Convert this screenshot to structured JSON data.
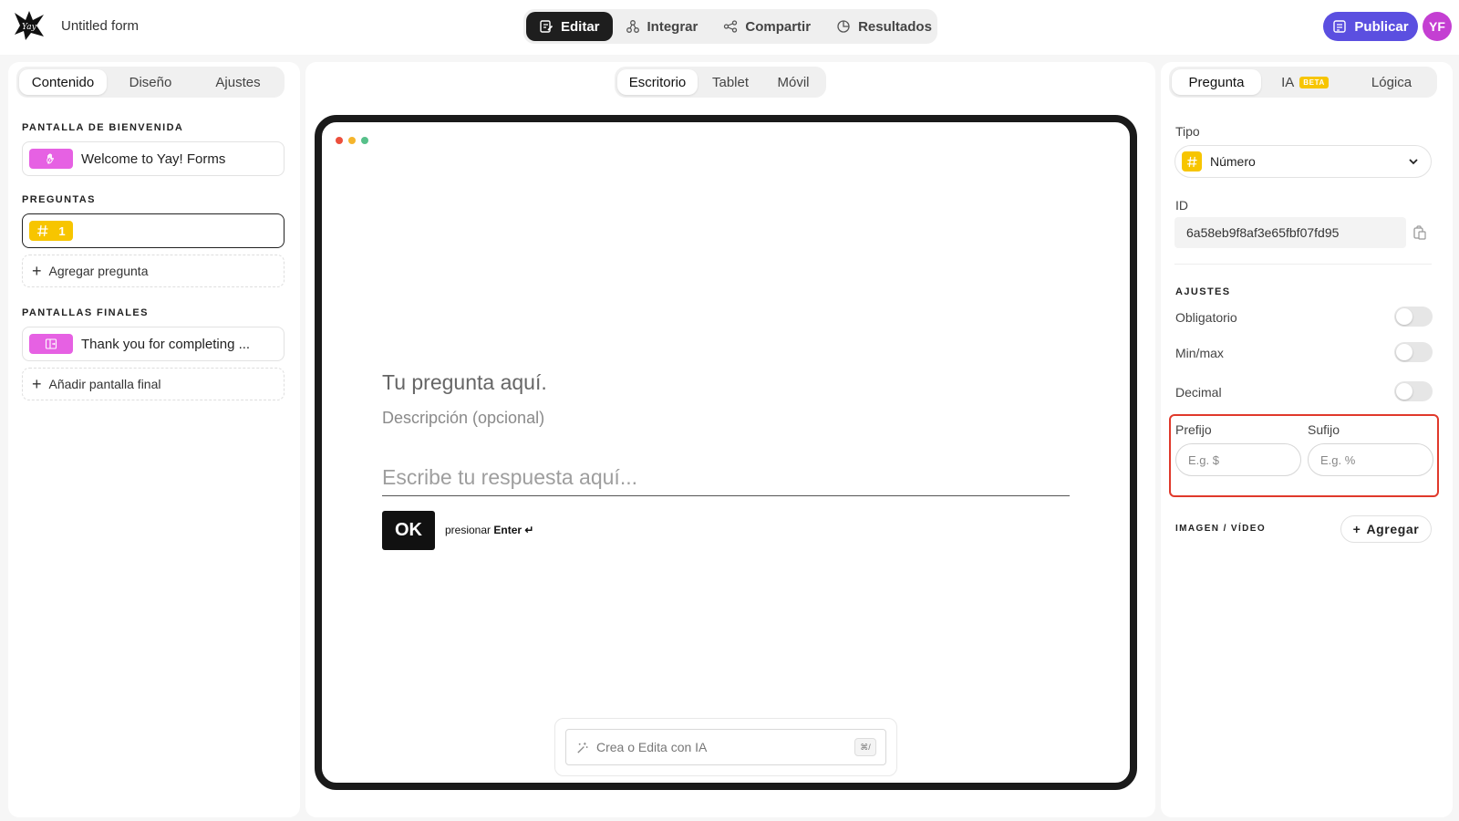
{
  "app": {
    "form_title": "Untitled form",
    "user_initials": "YF",
    "brand_colors": {
      "accent": "#5b4fe0",
      "avatar": "#c43fd2",
      "number_chip": "#f7c500",
      "screen_chip": "#e661e3",
      "highlight": "#e0392b"
    }
  },
  "header": {
    "tabs": [
      {
        "label": "Editar",
        "icon": "edit-icon",
        "active": true
      },
      {
        "label": "Integrar",
        "icon": "integrate-icon",
        "active": false
      },
      {
        "label": "Compartir",
        "icon": "share-icon",
        "active": false
      },
      {
        "label": "Resultados",
        "icon": "results-icon",
        "active": false
      }
    ],
    "publish_label": "Publicar"
  },
  "left": {
    "tabs": [
      {
        "label": "Contenido",
        "active": true
      },
      {
        "label": "Diseño",
        "active": false
      },
      {
        "label": "Ajustes",
        "active": false
      }
    ],
    "welcome_section": "PANTALLA DE BIENVENIDA",
    "welcome_item": "Welcome to Yay! Forms",
    "questions_section": "PREGUNTAS",
    "question_number": "1",
    "add_question": "Agregar pregunta",
    "endings_section": "PANTALLAS FINALES",
    "ending_item": "Thank you for completing ...",
    "add_ending": "Añadir pantalla final"
  },
  "center": {
    "devices": [
      {
        "label": "Escritorio",
        "active": true
      },
      {
        "label": "Tablet",
        "active": false
      },
      {
        "label": "Móvil",
        "active": false
      }
    ],
    "question_title": "Tu pregunta aquí.",
    "question_description": "Descripción (opcional)",
    "answer_placeholder": "Escribe tu respuesta aquí...",
    "ok_label": "OK",
    "enter_hint_prefix": "presionar",
    "enter_hint_key": "Enter ↵",
    "ai_placeholder": "Crea o Edita con IA",
    "ai_shortcut": "⌘/"
  },
  "right": {
    "tabs": [
      {
        "label": "Pregunta",
        "active": true
      },
      {
        "label": "IA",
        "badge": "BETA",
        "active": false
      },
      {
        "label": "Lógica",
        "active": false
      }
    ],
    "type_label": "Tipo",
    "type_value": "Número",
    "id_label": "ID",
    "id_value": "6a58eb9f8af3e65fbf07fd95",
    "settings_section": "AJUSTES",
    "toggles": [
      {
        "label": "Obligatorio",
        "on": false
      },
      {
        "label": "Min/max",
        "on": false
      },
      {
        "label": "Decimal",
        "on": false
      }
    ],
    "prefix_label": "Prefijo",
    "prefix_placeholder": "E.g. $",
    "suffix_label": "Sufijo",
    "suffix_placeholder": "E.g. %",
    "media_section": "IMAGEN / VÍDEO",
    "add_media": "Agregar"
  }
}
